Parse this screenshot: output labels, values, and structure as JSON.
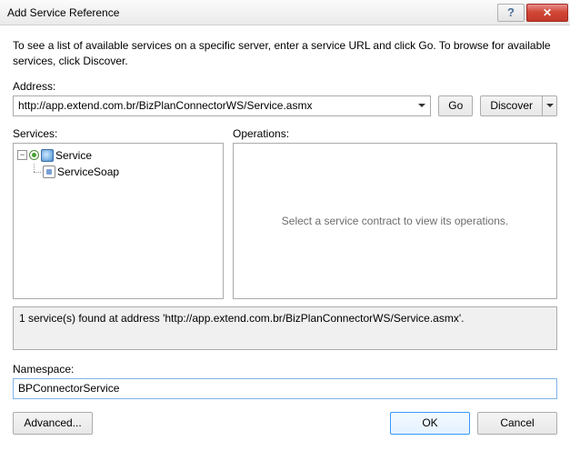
{
  "window": {
    "title": "Add Service Reference"
  },
  "intro": "To see a list of available services on a specific server, enter a service URL and click Go. To browse for available services, click Discover.",
  "address": {
    "label": "Address:",
    "value": "http://app.extend.com.br/BizPlanConnectorWS/Service.asmx",
    "go_label": "Go",
    "discover_label": "Discover"
  },
  "services": {
    "label": "Services:",
    "root": "Service",
    "child": "ServiceSoap"
  },
  "operations": {
    "label": "Operations:",
    "placeholder": "Select a service contract to view its operations."
  },
  "status": "1 service(s) found at address 'http://app.extend.com.br/BizPlanConnectorWS/Service.asmx'.",
  "namespace": {
    "label": "Namespace:",
    "value": "BPConnectorService"
  },
  "footer": {
    "advanced": "Advanced...",
    "ok": "OK",
    "cancel": "Cancel"
  }
}
